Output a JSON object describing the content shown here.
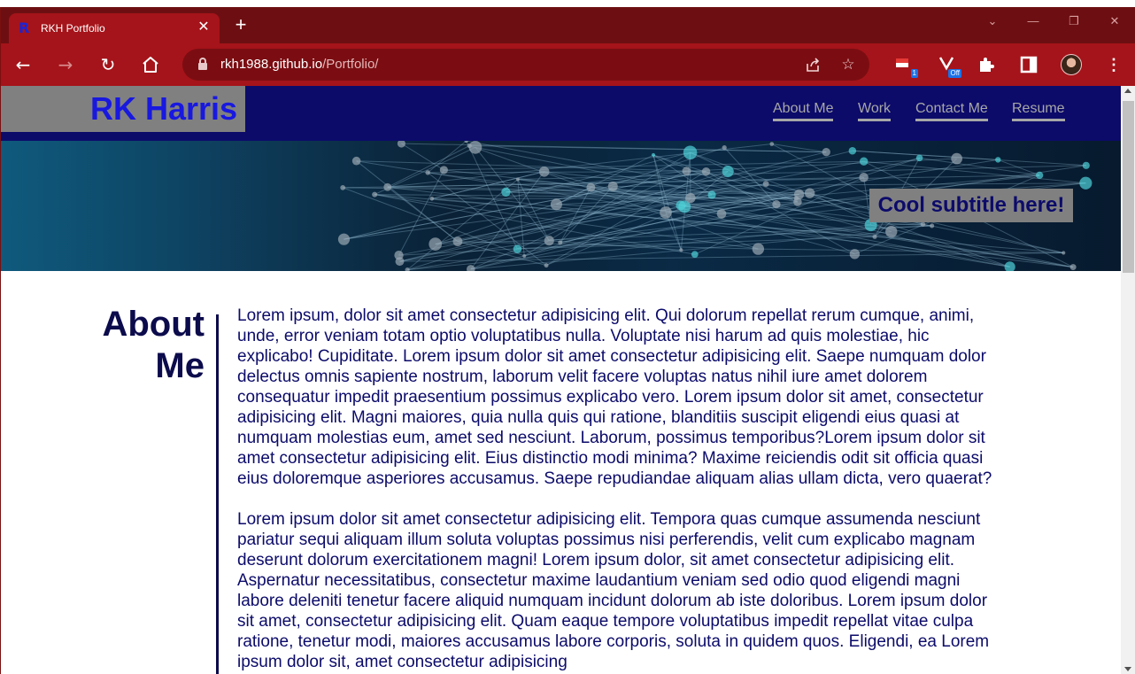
{
  "browser": {
    "tab": {
      "title": "RKH Portfolio",
      "favicon": "R"
    },
    "new_tab_glyph": "+",
    "url": {
      "host": "rkh1988.github.io",
      "path": "/Portfolio/"
    },
    "extensions": [
      {
        "name": "flag-extension-icon",
        "badge": "1"
      },
      {
        "name": "vpn-extension-icon",
        "badge": "Off"
      }
    ]
  },
  "site": {
    "logo": "RK Harris",
    "nav": [
      "About Me",
      "Work",
      "Contact Me",
      "Resume"
    ],
    "hero": {
      "subtitle": "Cool subtitle here!"
    },
    "about": {
      "title_line1": "About",
      "title_line2": "Me",
      "paragraphs": [
        "Lorem ipsum, dolor sit amet consectetur adipisicing elit. Qui dolorum repellat rerum cumque, animi, unde, error veniam totam optio voluptatibus nulla. Voluptate nisi harum ad quis molestiae, hic explicabo! Cupiditate. Lorem ipsum dolor sit amet consectetur adipisicing elit. Saepe numquam dolor delectus omnis sapiente nostrum, laborum velit facere voluptas natus nihil iure amet dolorem consequatur impedit praesentium possimus explicabo vero. Lorem ipsum dolor sit amet, consectetur adipisicing elit. Magni maiores, quia nulla quis qui ratione, blanditiis suscipit eligendi eius quasi at numquam molestias eum, amet sed nesciunt. Laborum, possimus temporibus?Lorem ipsum dolor sit amet consectetur adipisicing elit. Eius distinctio modi minima? Maxime reiciendis odit sit officia quasi eius doloremque asperiores accusamus. Saepe repudiandae aliquam alias ullam dicta, vero quaerat?",
        "Lorem ipsum dolor sit amet consectetur adipisicing elit. Tempora quas cumque assumenda nesciunt pariatur sequi aliquam illum soluta voluptas possimus nisi perferendis, velit cum explicabo magnam deserunt dolorum exercitationem magni! Lorem ipsum dolor, sit amet consectetur adipisicing elit. Aspernatur necessitatibus, consectetur maxime laudantium veniam sed odio quod eligendi magni labore deleniti tenetur facere aliquid numquam incidunt dolorum ab iste doloribus. Lorem ipsum dolor sit amet, consectetur adipisicing elit. Quam eaque tempore voluptatibus impedit repellat vitae culpa ratione, tenetur modi, maiores accusamus labore corporis, soluta in quidem quos. Eligendi, ea Lorem ipsum dolor sit, amet consectetur adipisicing"
      ]
    }
  },
  "colors": {
    "browser_frame": "#a5141a",
    "site_header": "#0c0b6a",
    "logo": "#1818e0",
    "logo_box": "#808080",
    "heading": "#0c0b4c"
  }
}
